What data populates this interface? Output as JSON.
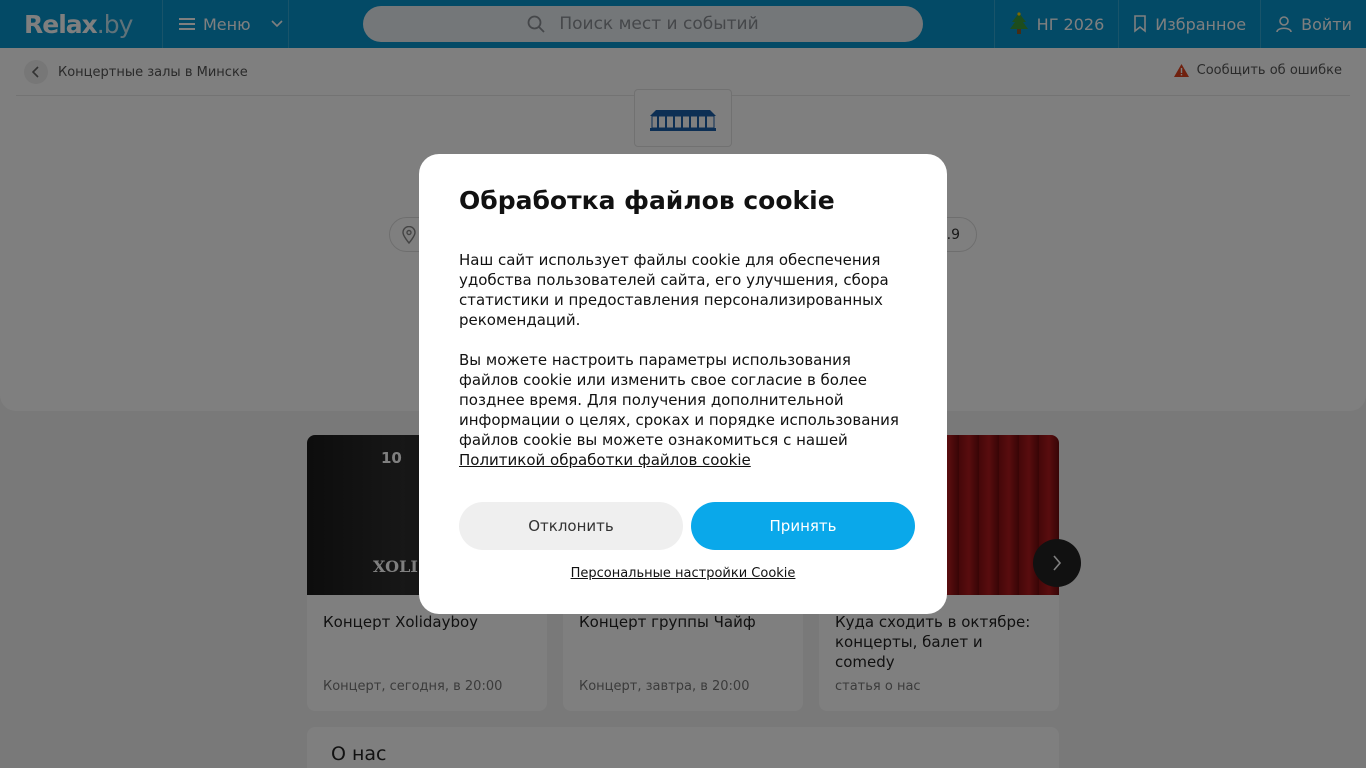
{
  "header": {
    "logo_main": "Relax",
    "logo_suffix": ".by",
    "menu_label": "Меню",
    "search_placeholder": "Поиск мест и событий",
    "ny_label": "НГ 2026",
    "favorites_label": "Избранное",
    "login_label": "Войти"
  },
  "page": {
    "breadcrumb": "Концертные залы в Минске",
    "report_error": "Сообщить об ошибке",
    "rating_fragment": ".9"
  },
  "cards": [
    {
      "title": "Концерт Xolidayboy",
      "meta": "Концерт, сегодня, в 20:00",
      "img_top": "10",
      "img_text": "XOLI"
    },
    {
      "title": "Концерт группы Чайф",
      "meta": "Концерт, завтра, в 20:00"
    },
    {
      "title": "Куда сходить в октябре: концерты, балет и comedy",
      "meta": "статья о нас"
    }
  ],
  "about": {
    "title": "О нас"
  },
  "cookie_modal": {
    "title": "Обработка файлов cookie",
    "paragraph1": "Наш сайт использует файлы cookie для обеспечения удобства пользователей сайта, его улучшения, сбора статистики и предоставления персонализированных рекомендаций.",
    "paragraph2": "Вы можете настроить параметры использования файлов cookie или изменить свое согласие в более позднее время. Для получения дополнительной информации о целях, сроках и порядке использования файлов cookie вы можете ознакомиться с нашей",
    "policy_link": "Политикой обработки файлов cookie",
    "decline_label": "Отклонить",
    "accept_label": "Принять",
    "settings_link": "Персональные настройки Cookie"
  },
  "colors": {
    "header_bg": "#0795cc",
    "accept_bg": "#0aa8ea"
  }
}
